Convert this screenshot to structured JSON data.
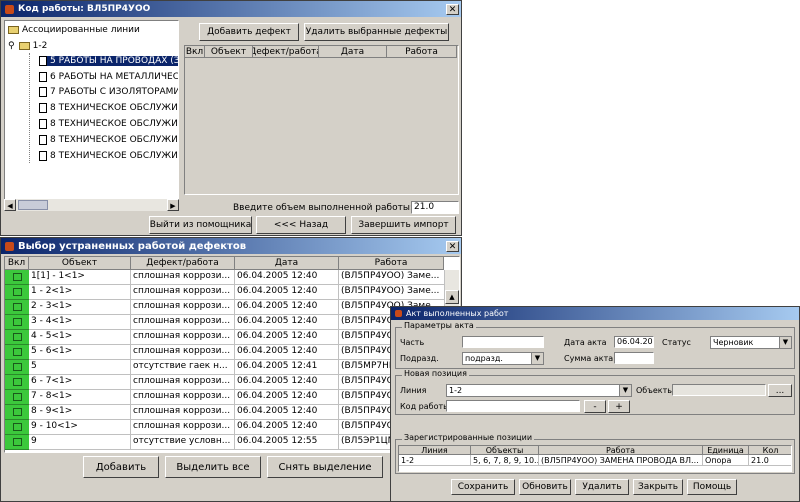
{
  "win1": {
    "title": "Код работы: ВЛ5ПР4УОО",
    "close_icon": "close-icon",
    "tree": {
      "root": "Ассоциированные линии",
      "group": "1-2",
      "items": [
        "5  РАБОТЫ НА ПРОВОДАХ (Зазем",
        "6  РАБОТЫ НА МЕТАЛЛИЧЕСКИХ",
        "7  РАБОТЫ С ИЗОЛЯТОРАМИ, Ф",
        "8  ТЕХНИЧЕСКОЕ ОБСЛУЖИВАН",
        "8  ТЕХНИЧЕСКОЕ ОБСЛУЖИВАН",
        "8  ТЕХНИЧЕСКОЕ ОБСЛУЖИВАН",
        "8  ТЕХНИЧЕСКОЕ ОБСЛУЖИВАН"
      ]
    },
    "add_defect_btn": "Добавить дефект",
    "remove_defects_btn": "Удалить выбранные дефекты",
    "cols": [
      "Вкл",
      "Объект",
      "Дефект/работа",
      "Дата",
      "Работа"
    ],
    "volume_label": "Введите объем выполненной работы:",
    "volume_value": "21.0",
    "exit_btn": "Выйти из помощника",
    "back_btn": "<<< Назад",
    "finish_btn": "Завершить импорт"
  },
  "win2": {
    "title": "Выбор устраненных работой дефектов",
    "cols": [
      "Вкл",
      "Объект",
      "Дефект/работа",
      "Дата",
      "Работа"
    ],
    "rows": [
      {
        "obj": "1[1] - 1<1>",
        "def": "сплошная коррози...",
        "date": "06.04.2005 12:40",
        "work": "(ВЛ5ПР4УОО) Заме..."
      },
      {
        "obj": "1 - 2<1>",
        "def": "сплошная коррози...",
        "date": "06.04.2005 12:40",
        "work": "(ВЛ5ПР4УОО) Заме..."
      },
      {
        "obj": "2 - 3<1>",
        "def": "сплошная коррози...",
        "date": "06.04.2005 12:40",
        "work": "(ВЛ5ПР4УОО) Заме..."
      },
      {
        "obj": "3 - 4<1>",
        "def": "сплошная коррози...",
        "date": "06.04.2005 12:40",
        "work": "(ВЛ5ПР4УО"
      },
      {
        "obj": "4 - 5<1>",
        "def": "сплошная коррози...",
        "date": "06.04.2005 12:40",
        "work": "(ВЛ5ПР4УО"
      },
      {
        "obj": "5 - 6<1>",
        "def": "сплошная коррози...",
        "date": "06.04.2005 12:40",
        "work": "(ВЛ5ПР4УО"
      },
      {
        "obj": "5",
        "def": "отсутствие гаек н...",
        "date": "06.04.2005 12:41",
        "work": "(ВЛ5МР7НК"
      },
      {
        "obj": "6 - 7<1>",
        "def": "сплошная коррози...",
        "date": "06.04.2005 12:40",
        "work": "(ВЛ5ПР4УО"
      },
      {
        "obj": "7 - 8<1>",
        "def": "сплошная коррози...",
        "date": "06.04.2005 12:40",
        "work": "(ВЛ5ПР4УО"
      },
      {
        "obj": "8 - 9<1>",
        "def": "сплошная коррози...",
        "date": "06.04.2005 12:40",
        "work": "(ВЛ5ПР4УО"
      },
      {
        "obj": "9 - 10<1>",
        "def": "сплошная коррози...",
        "date": "06.04.2005 12:40",
        "work": "(ВЛ5ПР4УО"
      },
      {
        "obj": "9",
        "def": "отсутствие условн...",
        "date": "06.04.2005 12:55",
        "work": "(ВЛ5ЭР1ЦМ"
      }
    ],
    "add_btn": "Добавить",
    "select_all_btn": "Выделить все",
    "deselect_btn": "Снять выделение"
  },
  "win3": {
    "title": "Акт выполненных работ",
    "params_group": "Параметры акта",
    "part_label": "Часть",
    "act_date_label": "Дата акта",
    "act_date_value": "06.04.2005",
    "status_label": "Статус",
    "status_value": "Черновик",
    "division_label": "Подразд.",
    "division_value": "подразд.",
    "act_sum_label": "Сумма акта",
    "new_pos_group": "Новая позиция",
    "line_label": "Линия",
    "line_value": "1-2",
    "objects_label": "Объекты",
    "objects_btn": "...",
    "work_code_label": "Код работы",
    "minus_btn": "-",
    "plus_btn": "+",
    "positions_group": "Зарегистрированные позиции",
    "pos_cols": [
      "Линия",
      "Объекты",
      "Работа",
      "Единица",
      "Кол"
    ],
    "pos_rows": [
      {
        "line": "1-2",
        "objects": "5, 6, 7, 8, 9, 10...",
        "work": "(ВЛ5ПР4УОО) ЗАМЕНА ПРОВОДА ВЛ...",
        "unit": "Опора",
        "qty": "21.0"
      }
    ],
    "save_btn": "Сохранить",
    "refresh_btn": "Обновить",
    "delete_btn": "Удалить",
    "close_btn": "Закрыть",
    "wizard_btn": "Помощь"
  }
}
